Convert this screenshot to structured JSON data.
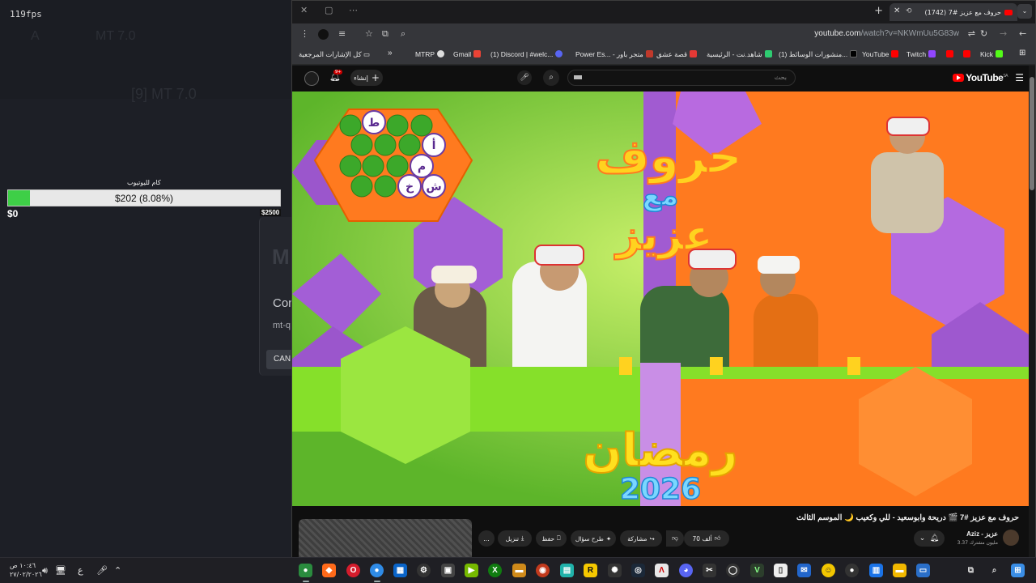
{
  "overlay": {
    "fps": "119fps",
    "ghost_title": "MT 7.0",
    "ghost_title_2": "[9] MT 7.0",
    "ghost_small": "A",
    "goal_title": "كام لليوتيوب",
    "goal_text": "$202 (8.08%)",
    "goal_progress": 0.0808,
    "goal_min": "$0",
    "goal_max": "$2500",
    "dialog_logo": "M",
    "dialog_heading": "Con",
    "dialog_text": "mt-q",
    "dialog_cancel": "CAN"
  },
  "browser": {
    "tab_title": "(1742) حروف مع عزيز #7",
    "url_host": "youtube.com",
    "url_path": "/watch?v=NKWmUu5G83w",
    "bookmarks": {
      "all": "كل الإشارات المرجعية",
      "overflow": "»",
      "mtrp": "MTRP",
      "gmail": "Gmail",
      "discord": "(1) Discord | #welc...",
      "power": "Power Es... - متجر باور",
      "qissat": "قصة عشق",
      "shahid": "شاهد.نت - الرئيسية",
      "x": "(1) منشورات الوسائط...",
      "youtube": "YouTube",
      "twitch": "Twitch",
      "kick": "Kick"
    }
  },
  "youtube": {
    "search_placeholder": "بحث",
    "create_label": "إنشاء",
    "notif_count": "9+",
    "logo_text": "YouTube",
    "logo_region": "SA",
    "video_title": "حروف مع عزيز #7 🎬 دريحة وابوسعيد - للي وكعيب 🌙 الموسم الثالث",
    "channel_name": "Aziz - عزيز",
    "channel_subs": "3.37 مليون مشترك",
    "likes": "70 ألف",
    "share": "مشاركة",
    "ask": "طرح سؤال",
    "save": "حفظ",
    "download": "تنزيل",
    "more": "...",
    "frame": {
      "title_line1": "حروف",
      "title_line2": "مع",
      "title_line3": "عزيز",
      "ramadan": "رمضان",
      "year": "2026",
      "hex_letters": [
        "ط",
        "أ",
        "م",
        "ش",
        "خ"
      ]
    }
  },
  "taskbar": {
    "time": "١٠:٤٦ ص",
    "date": "٢٧/٠٢/٢٠٢٦",
    "lang": "ع"
  }
}
